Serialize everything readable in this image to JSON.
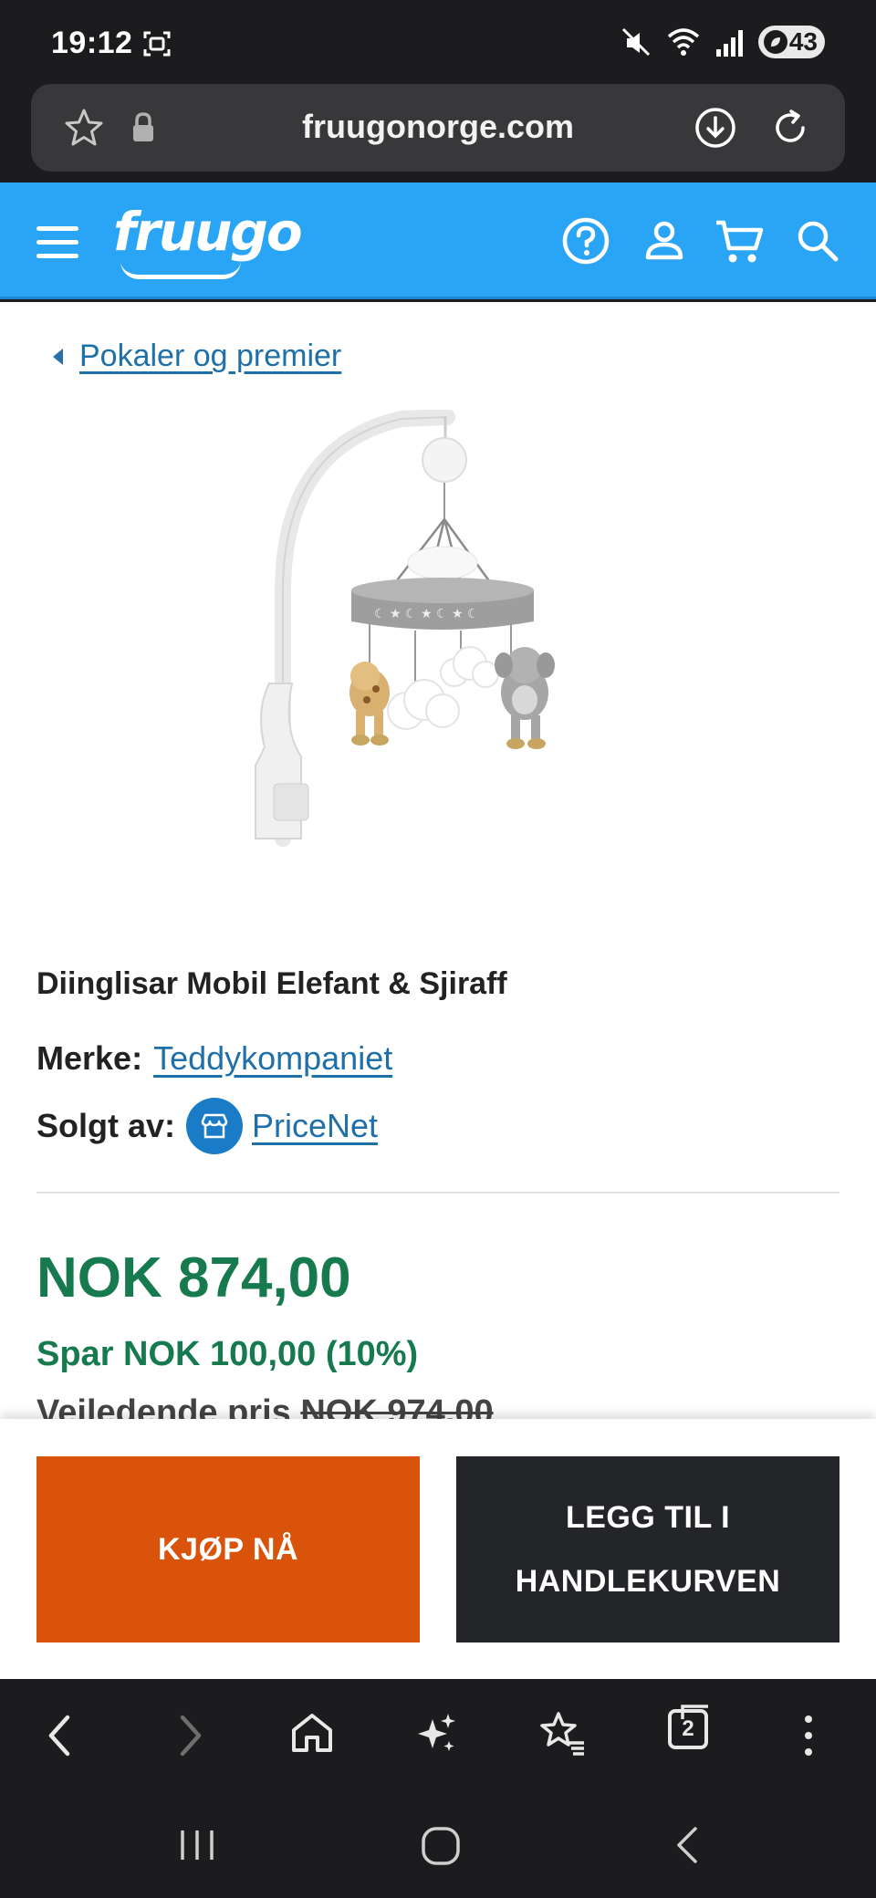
{
  "status_bar": {
    "time": "19:12",
    "battery": "43"
  },
  "browser": {
    "url": "fruugonorge.com",
    "tab_count": "2"
  },
  "site": {
    "logo": "fruugo"
  },
  "breadcrumb": {
    "label": "Pokaler og premier"
  },
  "product": {
    "title": "Diinglisar Mobil Elefant & Sjiraff",
    "brand_label": "Merke:",
    "brand": "Teddykompaniet",
    "seller_label": "Solgt av:",
    "seller": "PriceNet",
    "price": "NOK 874,00",
    "savings": "Spar NOK 100,00 (10%)",
    "rrp_label": "Veiledende pris",
    "rrp_value": "NOK 974,00"
  },
  "actions": {
    "buy_now": "KJØP NÅ",
    "add_to_cart_line1": "LEGG TIL I",
    "add_to_cart_line2": "HANDLEKURVEN"
  },
  "colors": {
    "header_blue": "#2aa5f5",
    "price_green": "#177a4e",
    "buy_orange": "#d9540a",
    "cart_dark": "#232529",
    "link_blue": "#1f6fa8"
  }
}
